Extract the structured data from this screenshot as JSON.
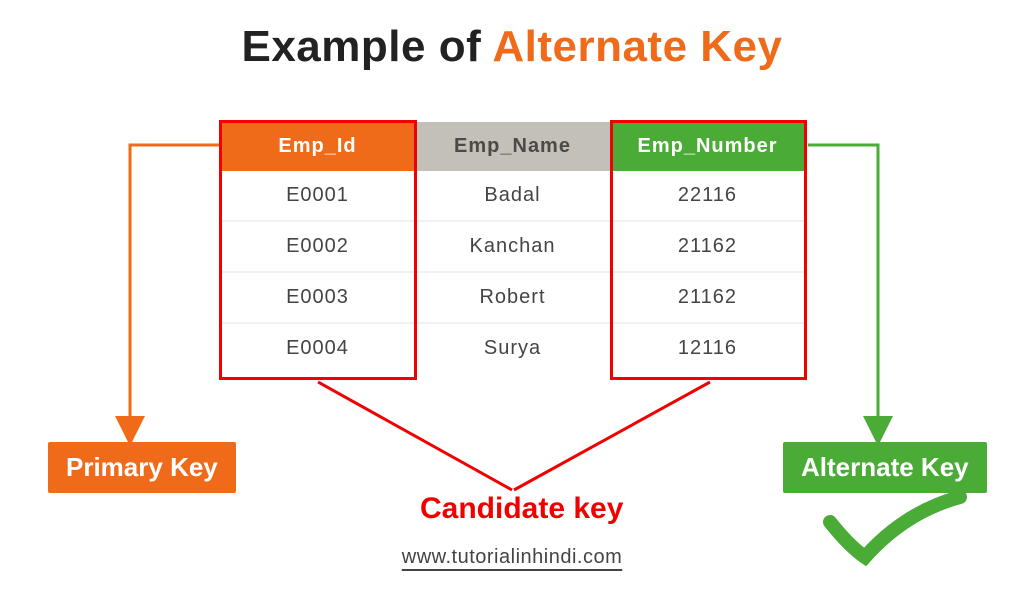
{
  "heading": {
    "part1": "Example of ",
    "part2": "Alternate Key"
  },
  "columns": {
    "id": "Emp_Id",
    "name": "Emp_Name",
    "number": "Emp_Number"
  },
  "rows": [
    {
      "id": "E0001",
      "name": "Badal",
      "number": "22116"
    },
    {
      "id": "E0002",
      "name": "Kanchan",
      "number": "21162"
    },
    {
      "id": "E0003",
      "name": "Robert",
      "number": "21162"
    },
    {
      "id": "E0004",
      "name": "Surya",
      "number": "12116"
    }
  ],
  "labels": {
    "primary": "Primary Key",
    "alternate": "Alternate Key",
    "candidate": "Candidate key"
  },
  "footer": "www.tutorialinhindi.com",
  "colors": {
    "orange": "#ef6b1a",
    "green": "#4aab36",
    "red": "#f20000",
    "gray": "#c2c0b7"
  }
}
